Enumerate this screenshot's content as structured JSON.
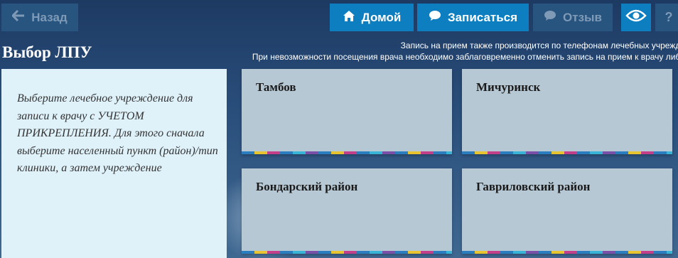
{
  "nav": {
    "back_label": "Назад",
    "home_label": "Домой",
    "book_label": "Записаться",
    "review_label": "Отзыв",
    "help_label": "?"
  },
  "notices": [
    "Запись на прием также производится по телефонам лечебных учрежде",
    "При невозможности посещения врача необходимо заблаговременно отменить запись на прием к врачу либо"
  ],
  "page_title": "Выбор ЛПУ",
  "info_text": "Выберите лечебное учреждение для записи к врачу с УЧЕТОМ ПРИКРЕПЛЕНИЯ. Для этого сначала выберите населенный пункт (район)/тип клиники, а затем учреждение",
  "locations": [
    {
      "name": "Тамбов"
    },
    {
      "name": "Мичуринск"
    },
    {
      "name": "Бондарский район"
    },
    {
      "name": "Гавриловский район"
    }
  ],
  "colors": {
    "primary_button": "#0d7fc1",
    "disabled_button": "#28557f",
    "card": "#b6c8d3",
    "info_panel": "#dff2f9"
  }
}
